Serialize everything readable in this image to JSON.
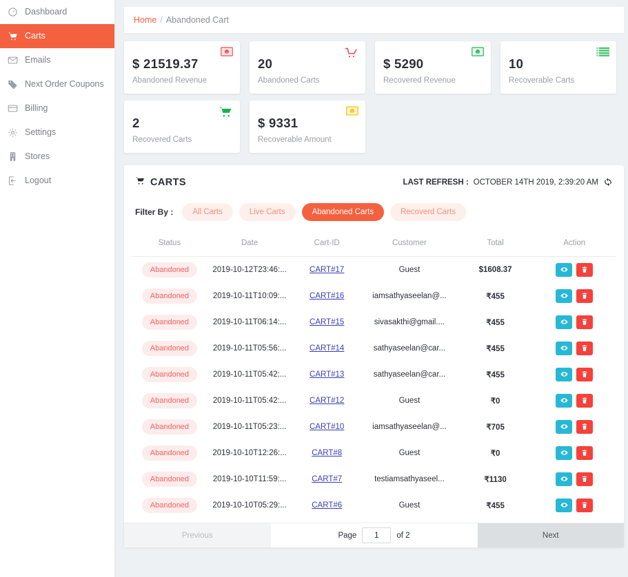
{
  "sidebar": {
    "items": [
      {
        "label": "Dashboard",
        "icon": "speedometer-icon",
        "active": false
      },
      {
        "label": "Carts",
        "icon": "cart-icon",
        "active": true
      },
      {
        "label": "Emails",
        "icon": "envelope-icon",
        "active": false
      },
      {
        "label": "Next Order Coupons",
        "icon": "tag-icon",
        "active": false
      },
      {
        "label": "Billing",
        "icon": "credit-card-icon",
        "active": false
      },
      {
        "label": "Settings",
        "icon": "gear-icon",
        "active": false
      },
      {
        "label": "Stores",
        "icon": "building-icon",
        "active": false
      },
      {
        "label": "Logout",
        "icon": "logout-icon",
        "active": false
      }
    ]
  },
  "breadcrumb": {
    "home": "Home",
    "separator": "/",
    "current": "Abandoned Cart"
  },
  "stat_cards": [
    {
      "value": "$ 21519.37",
      "label": "Abandoned Revenue",
      "icon": "banknote-icon",
      "color": "#ef4f52"
    },
    {
      "value": "20",
      "label": "Abandoned Carts",
      "icon": "cart-outline-icon",
      "color": "#ef4f6b"
    },
    {
      "value": "$ 5290",
      "label": "Recovered Revenue",
      "icon": "banknote-icon",
      "color": "#2eb35c"
    },
    {
      "value": "10",
      "label": "Recoverable Carts",
      "icon": "list-icon",
      "color": "#48c16f"
    },
    {
      "value": "2",
      "label": "Recovered Carts",
      "icon": "cart-filled-icon",
      "color": "#18b254"
    },
    {
      "value": "$ 9331",
      "label": "Recoverable Amount",
      "icon": "banknote-icon",
      "color": "#f2c617"
    }
  ],
  "panel": {
    "title": "CARTS",
    "title_icon": "cart-icon",
    "refresh_label": "LAST REFRESH :",
    "refresh_value": "OCTOBER 14TH 2019, 2:39:20 AM",
    "refresh_icon": "sync-icon",
    "filter_caption": "Filter By :",
    "filters": [
      {
        "label": "All Carts",
        "active": false
      },
      {
        "label": "Live Carts",
        "active": false
      },
      {
        "label": "Abandoned Carts",
        "active": true
      },
      {
        "label": "Recoverd Carts",
        "active": false
      }
    ]
  },
  "table": {
    "headers": [
      "Status",
      "Date",
      "Cart-ID",
      "Customer",
      "Total",
      "Action"
    ],
    "rows": [
      {
        "status": "Abandoned",
        "date": "2019-10-12T23:46:...",
        "cart_id": "CART#17",
        "customer": "Guest",
        "total": "$1608.37"
      },
      {
        "status": "Abandoned",
        "date": "2019-10-11T10:09:...",
        "cart_id": "CART#16",
        "customer": "iamsathyaseelan@...",
        "total": "₹455"
      },
      {
        "status": "Abandoned",
        "date": "2019-10-11T06:14:...",
        "cart_id": "CART#15",
        "customer": "sivasakthi@gmail....",
        "total": "₹455"
      },
      {
        "status": "Abandoned",
        "date": "2019-10-11T05:56:...",
        "cart_id": "CART#14",
        "customer": "sathyaseelan@car...",
        "total": "₹455"
      },
      {
        "status": "Abandoned",
        "date": "2019-10-11T05:42:...",
        "cart_id": "CART#13",
        "customer": "sathyaseelan@car...",
        "total": "₹455"
      },
      {
        "status": "Abandoned",
        "date": "2019-10-11T05:42:...",
        "cart_id": "CART#12",
        "customer": "Guest",
        "total": "₹0"
      },
      {
        "status": "Abandoned",
        "date": "2019-10-11T05:23:...",
        "cart_id": "CART#10",
        "customer": "iamsathyaseelan@...",
        "total": "₹705"
      },
      {
        "status": "Abandoned",
        "date": "2019-10-10T12:26:...",
        "cart_id": "CART#8",
        "customer": "Guest",
        "total": "₹0"
      },
      {
        "status": "Abandoned",
        "date": "2019-10-10T11:59:...",
        "cart_id": "CART#7",
        "customer": "testiamsathyaseel...",
        "total": "₹1130"
      },
      {
        "status": "Abandoned",
        "date": "2019-10-10T05:29:...",
        "cart_id": "CART#6",
        "customer": "Guest",
        "total": "₹455"
      }
    ],
    "action_icons": {
      "view": "eye-icon",
      "delete": "trash-icon"
    }
  },
  "pagination": {
    "previous": "Previous",
    "next": "Next",
    "page_label": "Page",
    "page_value": "1",
    "of_label": "of 2"
  },
  "colors": {
    "accent": "#f4613f",
    "chip_bg": "#fdf0ec",
    "badge_bg": "#fdecec",
    "badge_text": "#f4615f",
    "view_btn": "#27b8d6",
    "delete_btn": "#f4413c",
    "link": "#3b3bbd",
    "page_bg": "#eef1f3"
  }
}
